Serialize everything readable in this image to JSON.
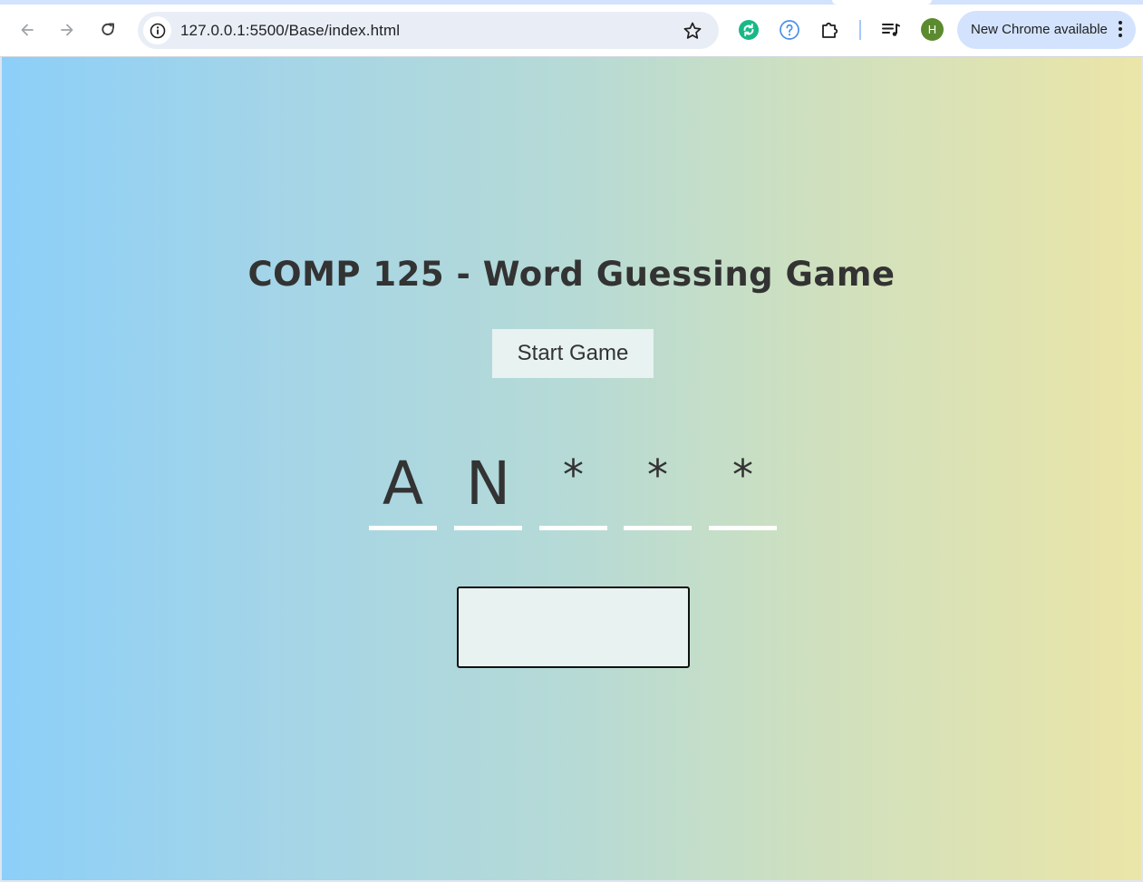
{
  "browser": {
    "url": "127.0.0.1:5500/Base/index.html",
    "profile_initial": "H",
    "update_label": "New Chrome available",
    "icons": [
      "back-arrow-icon",
      "forward-arrow-icon",
      "reload-icon",
      "site-info-icon",
      "bookmark-star-icon",
      "sync-extension-icon",
      "help-extension-icon",
      "extensions-puzzle-icon",
      "media-control-icon",
      "more-menu-icon"
    ],
    "colors": {
      "pill": "#d3e3fd",
      "omnibox": "#e9eef6",
      "avatar": "#5b8a2f"
    }
  },
  "game": {
    "title": "COMP 125 - Word Guessing Game",
    "start_button": "Start Game",
    "slots": [
      "A",
      "N",
      "*",
      "*",
      "*"
    ],
    "guess_input_value": "",
    "colors": {
      "gradient_start": "#8ccff8",
      "gradient_end": "#ebe5a8",
      "text": "#333333",
      "underline": "#ffffff"
    }
  }
}
